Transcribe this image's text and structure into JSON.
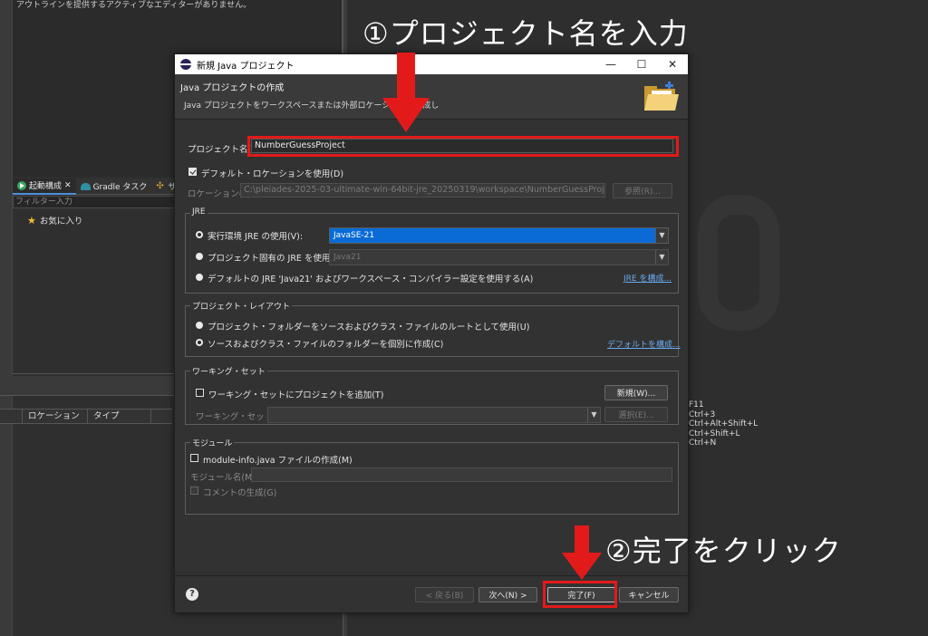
{
  "ide": {
    "outline_message": "アウトラインを提供するアクティブなエディターがありません。",
    "launch_tabs": [
      {
        "label": "起動構成",
        "close": "✕"
      },
      {
        "label": "Gradle タスク"
      },
      {
        "label": "サ"
      }
    ],
    "filter_placeholder": "フィルター入力",
    "favorites_label": "お気に入り",
    "table_headers": [
      "ロケーション",
      "タイプ"
    ],
    "shortcuts": [
      "F11",
      "Ctrl+3",
      "Ctrl+Alt+Shift+L",
      "Ctrl+Shift+L",
      "Ctrl+N"
    ]
  },
  "dialog": {
    "title": "新規 Java プロジェクト",
    "window_buttons": {
      "minimize": "—",
      "maximize": "☐",
      "close": "✕"
    },
    "header_title": "Java プロジェクトの作成",
    "header_desc": "Java プロジェクトをワークスペースまたは外部ロケーションに作成し",
    "project_name_label": "プロジェクト名(P):",
    "project_name_value": "NumberGuessProject",
    "default_location_label": "デフォルト・ロケーションを使用(D)",
    "location_label": "ロケーション(L):",
    "location_value": "C:\\pleiades-2025-03-ultimate-win-64bit-jre_20250319\\workspace\\NumberGuessProject",
    "browse_label": "参照(R)...",
    "jre": {
      "title": "JRE",
      "option1": "実行環境 JRE の使用(V):",
      "option1_value": "JavaSE-21",
      "option2": "プロジェクト固有の JRE を使用(S):",
      "option2_value": "Java21",
      "option3": "デフォルトの JRE 'Java21' およびワークスペース・コンパイラー設定を使用する(A)",
      "configure_link": "JRE を構成..."
    },
    "layout": {
      "title": "プロジェクト・レイアウト",
      "option1": "プロジェクト・フォルダーをソースおよびクラス・ファイルのルートとして使用(U)",
      "option2": "ソースおよびクラス・ファイルのフォルダーを個別に作成(C)",
      "configure_link": "デフォルトを構成..."
    },
    "working_sets": {
      "title": "ワーキング・セット",
      "add_label": "ワーキング・セットにプロジェクトを追加(T)",
      "new_button": "新規(W)...",
      "sets_label": "ワーキング・セット(O):",
      "select_button": "選択(E)..."
    },
    "module": {
      "title": "モジュール",
      "create_label": "module-info.java ファイルの作成(M)",
      "name_label": "モジュール名(M):",
      "comment_label": "コメントの生成(G)"
    },
    "footer": {
      "help": "?",
      "back": "< 戻る(B)",
      "next": "次へ(N) >",
      "finish": "完了(F)",
      "cancel": "キャンセル"
    }
  },
  "annotations": {
    "step1": "①プロジェクト名を入力",
    "step2": "②完了をクリック",
    "color": "#e31a1a"
  }
}
